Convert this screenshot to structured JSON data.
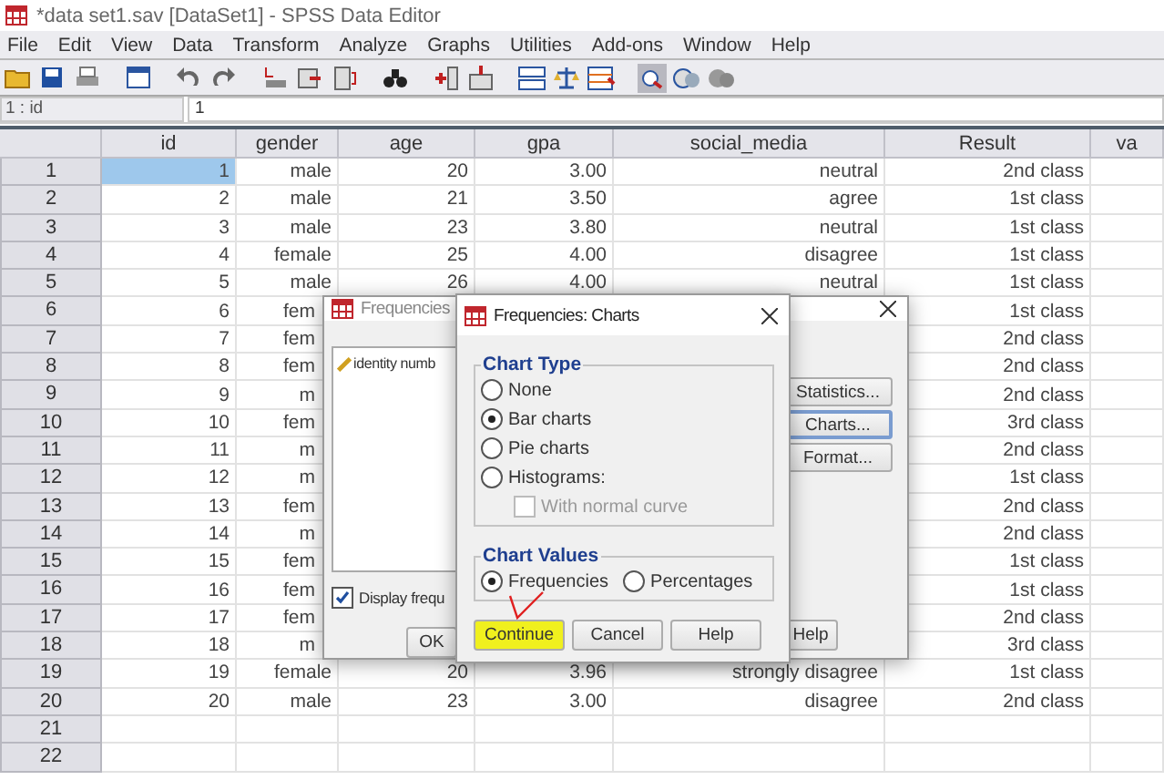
{
  "window": {
    "title": "*data set1.sav [DataSet1] - SPSS Data Editor"
  },
  "menu": [
    "File",
    "Edit",
    "View",
    "Data",
    "Transform",
    "Analyze",
    "Graphs",
    "Utilities",
    "Add-ons",
    "Window",
    "Help"
  ],
  "cell_bar": {
    "reference": "1 : id",
    "value": "1"
  },
  "table": {
    "columns": [
      "id",
      "gender",
      "age",
      "gpa",
      "social_media",
      "Result",
      "va"
    ],
    "rows": [
      {
        "number": "1",
        "selected": true,
        "id": "1",
        "gender": "male",
        "age": "20",
        "gpa": "3.00",
        "social_media": "neutral",
        "result": "2nd class"
      },
      {
        "number": "2",
        "selected": false,
        "id": "2",
        "gender": "male",
        "age": "21",
        "gpa": "3.50",
        "social_media": "agree",
        "result": "1st class"
      },
      {
        "number": "3",
        "selected": false,
        "id": "3",
        "gender": "male",
        "age": "23",
        "gpa": "3.80",
        "social_media": "neutral",
        "result": "1st class"
      },
      {
        "number": "4",
        "selected": false,
        "id": "4",
        "gender": "female",
        "age": "25",
        "gpa": "4.00",
        "social_media": "disagree",
        "result": "1st class"
      },
      {
        "number": "5",
        "selected": false,
        "id": "5",
        "gender": "male",
        "age": "26",
        "gpa": "4.00",
        "social_media": "neutral",
        "result": "1st class"
      },
      {
        "number": "6",
        "selected": false,
        "id": "6",
        "gender": "fem",
        "result": "1st class"
      },
      {
        "number": "7",
        "selected": false,
        "id": "7",
        "gender": "fem",
        "result": "2nd class"
      },
      {
        "number": "8",
        "selected": false,
        "id": "8",
        "gender": "fem",
        "result": "2nd class"
      },
      {
        "number": "9",
        "selected": false,
        "id": "9",
        "gender": "m",
        "result": "2nd class"
      },
      {
        "number": "10",
        "selected": false,
        "id": "10",
        "gender": "fem",
        "result": "3rd class"
      },
      {
        "number": "11",
        "selected": false,
        "id": "11",
        "gender": "m",
        "result": "2nd class"
      },
      {
        "number": "12",
        "selected": false,
        "id": "12",
        "gender": "m",
        "result": "1st class"
      },
      {
        "number": "13",
        "selected": false,
        "id": "13",
        "gender": "fem",
        "result": "2nd class"
      },
      {
        "number": "14",
        "selected": false,
        "id": "14",
        "gender": "m",
        "result": "2nd class"
      },
      {
        "number": "15",
        "selected": false,
        "id": "15",
        "gender": "fem",
        "result": "1st class"
      },
      {
        "number": "16",
        "selected": false,
        "id": "16",
        "gender": "fem",
        "result": "1st class"
      },
      {
        "number": "17",
        "selected": false,
        "id": "17",
        "gender": "fem",
        "result": "2nd class"
      },
      {
        "number": "18",
        "selected": false,
        "id": "18",
        "gender": "m",
        "result": "3rd class"
      },
      {
        "number": "19",
        "selected": false,
        "id": "19",
        "gender": "female",
        "age": "20",
        "gpa": "3.96",
        "social_media": "strongly disagree",
        "result": "1st class"
      },
      {
        "number": "20",
        "selected": false,
        "id": "20",
        "gender": "male",
        "age": "23",
        "gpa": "3.00",
        "social_media": "disagree",
        "result": "2nd class"
      },
      {
        "number": "21",
        "selected": false
      },
      {
        "number": "22",
        "selected": false
      }
    ]
  },
  "frequencies_dialog": {
    "title": "Frequencies",
    "active": false,
    "variables": [
      "identity numb"
    ],
    "display_tables": {
      "label": "Display frequ",
      "checked": true
    },
    "side_buttons": [
      {
        "label": "Statistics...",
        "focused": false
      },
      {
        "label": "Charts...",
        "focused": true
      },
      {
        "label": "Format...",
        "focused": false
      }
    ],
    "buttons": [
      "OK",
      "Help"
    ]
  },
  "charts_dialog": {
    "title": "Frequencies: Charts",
    "active": true,
    "chart_type": {
      "title": "Chart Type",
      "options": [
        {
          "label": "None",
          "selected": false
        },
        {
          "label": "Bar charts",
          "selected": true
        },
        {
          "label": "Pie charts",
          "selected": false
        },
        {
          "label": "Histograms:",
          "selected": false
        }
      ],
      "normal_curve": {
        "label": "With normal curve",
        "checked": false,
        "disabled": true
      }
    },
    "chart_values": {
      "title": "Chart Values",
      "options": [
        {
          "label": "Frequencies",
          "selected": true
        },
        {
          "label": "Percentages",
          "selected": false
        }
      ]
    },
    "buttons": [
      {
        "label": "Continue",
        "highlighted": true
      },
      {
        "label": "Cancel",
        "highlighted": false
      },
      {
        "label": "Help",
        "highlighted": false
      }
    ]
  }
}
